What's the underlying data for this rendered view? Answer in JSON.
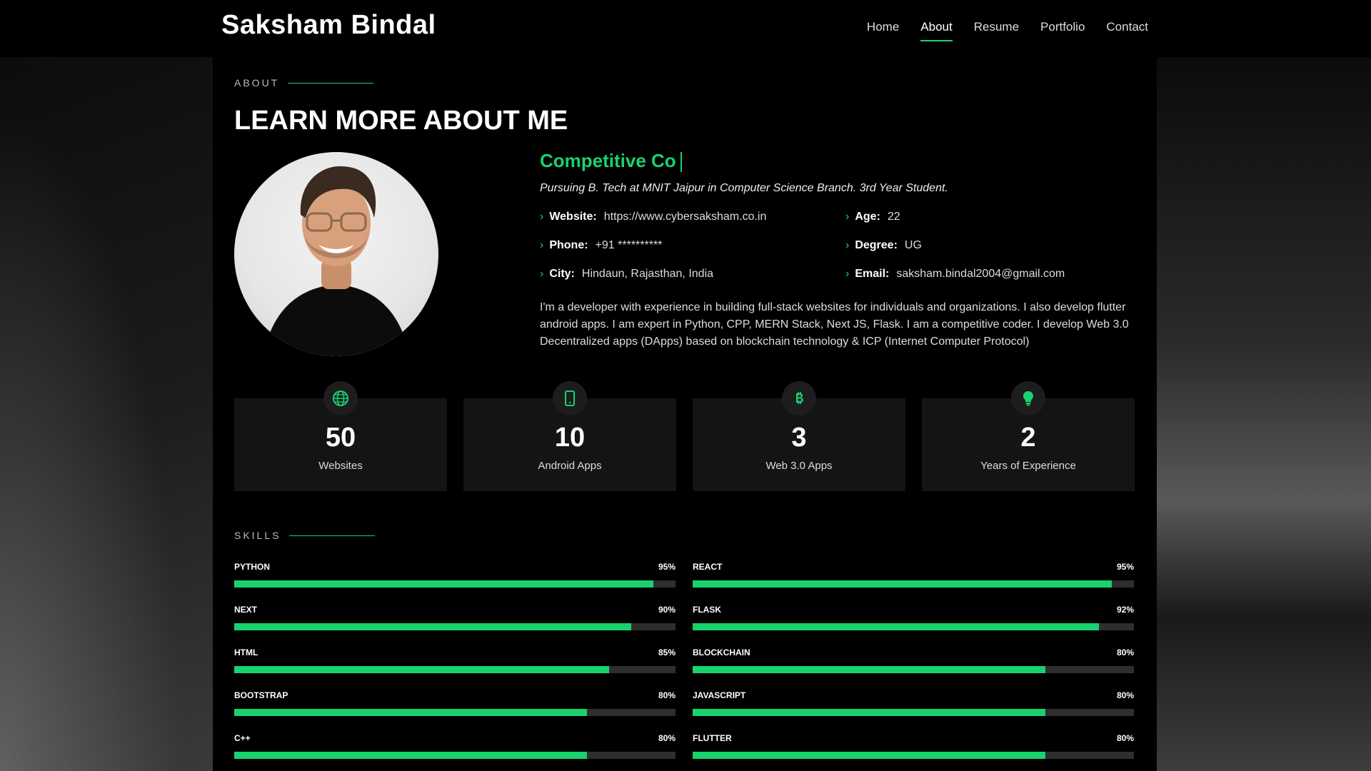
{
  "header": {
    "logo": "Saksham Bindal",
    "nav": [
      {
        "label": "Home",
        "active": false
      },
      {
        "label": "About",
        "active": true
      },
      {
        "label": "Resume",
        "active": false
      },
      {
        "label": "Portfolio",
        "active": false
      },
      {
        "label": "Contact",
        "active": false
      }
    ]
  },
  "about": {
    "tag": "ABOUT",
    "title": "LEARN MORE ABOUT ME",
    "role_typed": "Competitive Co",
    "tagline": "Pursuing B. Tech at MNIT Jaipur in Computer Science Branch. 3rd Year Student.",
    "facts": [
      {
        "key": "Website:",
        "value": "https://www.cybersaksham.co.in"
      },
      {
        "key": "Age:",
        "value": "22"
      },
      {
        "key": "Phone:",
        "value": "+91 **********"
      },
      {
        "key": "Degree:",
        "value": "UG"
      },
      {
        "key": "City:",
        "value": "Hindaun, Rajasthan, India"
      },
      {
        "key": "Email:",
        "value": "saksham.bindal2004@gmail.com"
      }
    ],
    "bio": "I'm a developer with experience in building full-stack websites for individuals and organizations. I also develop flutter android apps. I am expert in Python, CPP, MERN Stack, Next JS, Flask. I am a competitive coder. I develop Web 3.0 Decentralized apps (DApps) based on blockchain technology & ICP (Internet Computer Protocol)"
  },
  "stats": [
    {
      "icon": "globe-icon",
      "number": "50",
      "label": "Websites"
    },
    {
      "icon": "phone-icon",
      "number": "10",
      "label": "Android Apps"
    },
    {
      "icon": "bitcoin-icon",
      "number": "3",
      "label": "Web 3.0 Apps"
    },
    {
      "icon": "lightbulb-icon",
      "number": "2",
      "label": "Years of Experience"
    }
  ],
  "skills": {
    "tag": "SKILLS",
    "items": [
      {
        "name": "PYTHON",
        "percent_label": "95%",
        "level": 0.95
      },
      {
        "name": "REACT",
        "percent_label": "95%",
        "level": 0.95
      },
      {
        "name": "NEXT",
        "percent_label": "90%",
        "level": 0.9
      },
      {
        "name": "FLASK",
        "percent_label": "92%",
        "level": 0.92
      },
      {
        "name": "HTML",
        "percent_label": "85%",
        "level": 0.85
      },
      {
        "name": "BLOCKCHAIN",
        "percent_label": "80%",
        "level": 0.8
      },
      {
        "name": "BOOTSTRAP",
        "percent_label": "80%",
        "level": 0.8
      },
      {
        "name": "JAVASCRIPT",
        "percent_label": "80%",
        "level": 0.8
      },
      {
        "name": "C++",
        "percent_label": "80%",
        "level": 0.8
      },
      {
        "name": "FLUTTER",
        "percent_label": "80%",
        "level": 0.8
      }
    ]
  },
  "colors": {
    "accent": "#18d26e",
    "card": "#141414",
    "track": "#2e2e2e"
  }
}
